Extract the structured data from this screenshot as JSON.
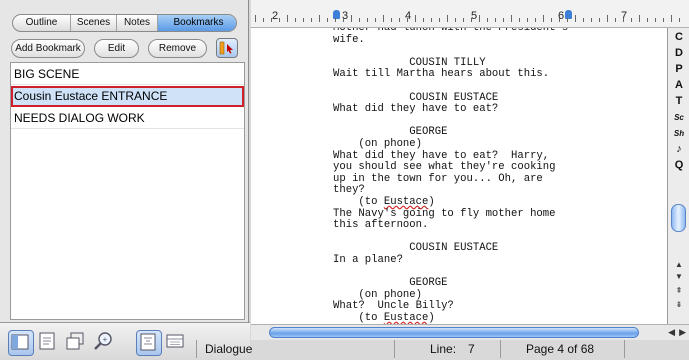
{
  "sidebar": {
    "tabs": [
      {
        "label": "Outline"
      },
      {
        "label": "Scenes"
      },
      {
        "label": "Notes"
      },
      {
        "label": "Bookmarks"
      }
    ],
    "active_tab": "Bookmarks",
    "buttons": {
      "add": "Add Bookmark",
      "edit": "Edit",
      "remove": "Remove"
    },
    "bookmarks": [
      {
        "label": "BIG SCENE"
      },
      {
        "label": "Cousin Eustace ENTRANCE"
      },
      {
        "label": "NEEDS DIALOG WORK"
      }
    ],
    "selected_bookmark": "Cousin Eustace ENTRANCE"
  },
  "ruler": {
    "numbers": [
      "2",
      "3",
      "4",
      "5",
      "6",
      "7"
    ]
  },
  "script": {
    "lines": [
      {
        "text": "Mother had lunch with the President's"
      },
      {
        "text": "wife."
      },
      {
        "text": ""
      },
      {
        "text": "            COUSIN TILLY"
      },
      {
        "text": "Wait till Martha hears about this."
      },
      {
        "text": ""
      },
      {
        "text": "            COUSIN EUSTACE"
      },
      {
        "text": "What did they have to eat?"
      },
      {
        "text": ""
      },
      {
        "text": "            GEORGE"
      },
      {
        "text": "    (on phone)"
      },
      {
        "text": "What did they have to eat?  Harry,"
      },
      {
        "text": "you should see what they're cooking"
      },
      {
        "text": "up in the town for you... Oh, are"
      },
      {
        "text": "they?"
      },
      {
        "text": "    (to Eustace)"
      },
      {
        "text": "The Navy's going to fly mother home"
      },
      {
        "text": "this afternoon."
      },
      {
        "text": ""
      },
      {
        "text": "            COUSIN EUSTACE"
      },
      {
        "text": "In a plane?"
      },
      {
        "text": ""
      },
      {
        "text": "            GEORGE"
      },
      {
        "text": "    (on phone)"
      },
      {
        "text": "What?  Uncle Billy?"
      },
      {
        "text": "    (to Eustace)"
      }
    ]
  },
  "palette": {
    "buttons": [
      "C",
      "D",
      "P",
      "A",
      "T",
      "Sc",
      "Sh",
      "♪",
      "Q"
    ]
  },
  "status": {
    "element": "Dialogue",
    "line_label": "Line:",
    "line_value": "7",
    "page": "Page 4 of 68"
  },
  "colors": {
    "selection_outline": "#d0202a",
    "accent": "#5b9ae6"
  }
}
